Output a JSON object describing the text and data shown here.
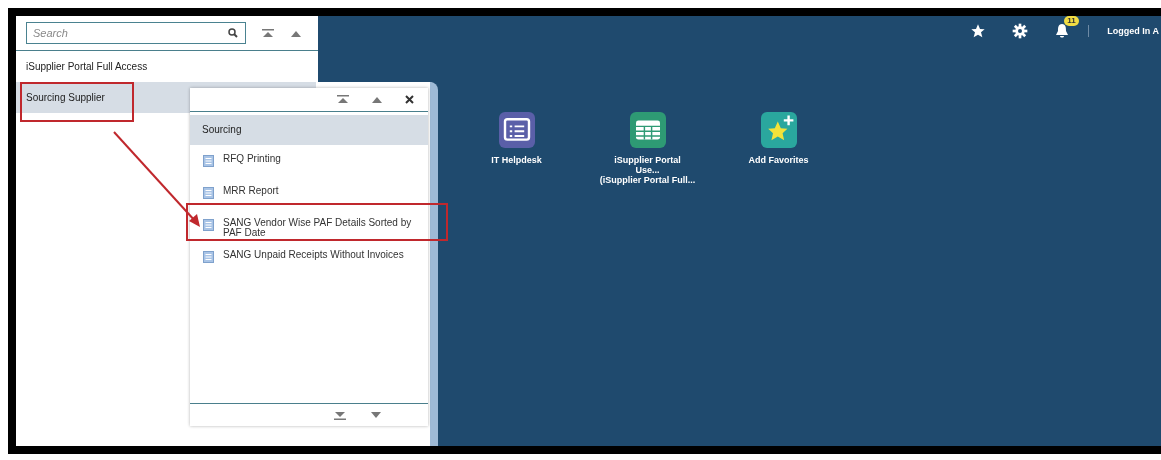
{
  "sidebar": {
    "search": {
      "placeholder": "Search"
    },
    "items": [
      {
        "label": "iSupplier Portal Full Access",
        "selected": false,
        "highlighted": false
      },
      {
        "label": "Sourcing Supplier",
        "selected": true,
        "highlighted": true
      }
    ]
  },
  "popup": {
    "section": "Sourcing",
    "items": [
      {
        "label": "RFQ Printing",
        "highlighted": false
      },
      {
        "label": "MRR Report",
        "highlighted": false
      },
      {
        "label": "SANG Vendor Wise PAF Details Sorted by PAF Date",
        "highlighted": true
      },
      {
        "label": "SANG Unpaid Receipts Without Invoices",
        "highlighted": false
      }
    ]
  },
  "annotation_arrow": true,
  "header": {
    "notification_count": "11",
    "user": "Logged In A"
  },
  "tiles": [
    {
      "kind": "list",
      "label": "IT Helpdesk"
    },
    {
      "kind": "table",
      "label": "iSupplier Portal Use...",
      "sublabel": "(iSupplier Portal Full..."
    },
    {
      "kind": "favorite",
      "label": "Add Favorites"
    }
  ]
}
